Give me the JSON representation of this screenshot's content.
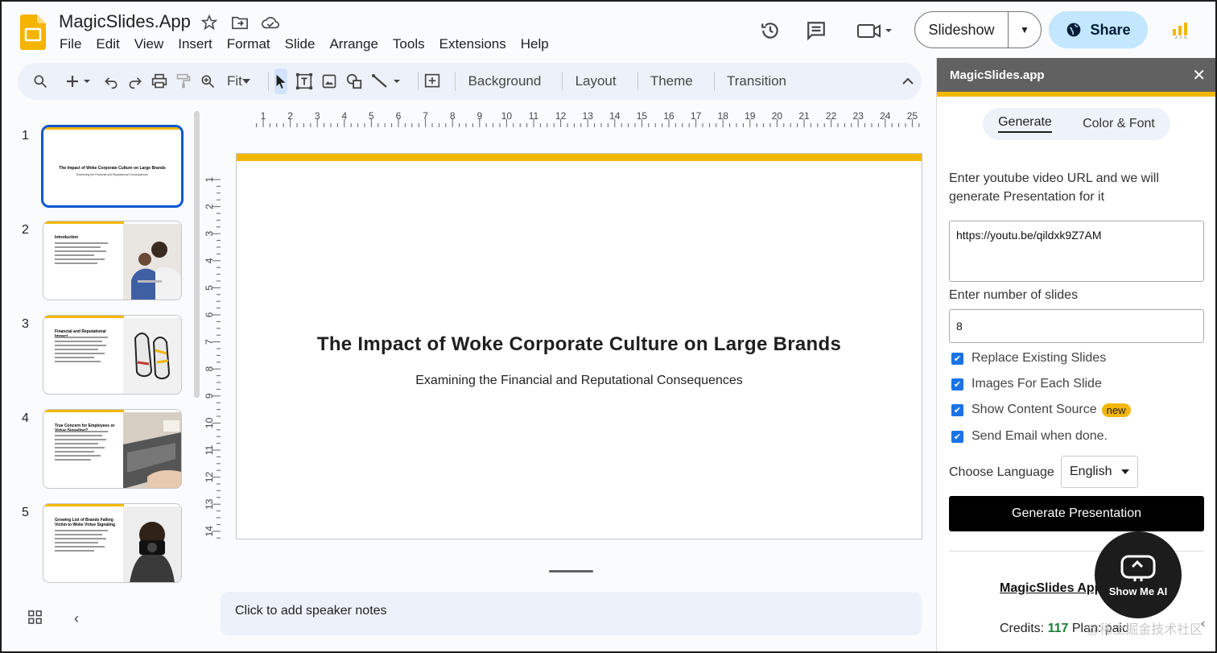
{
  "app": {
    "title": "MagicSlides.App",
    "menu": [
      "File",
      "Edit",
      "View",
      "Insert",
      "Format",
      "Slide",
      "Arrange",
      "Tools",
      "Extensions",
      "Help"
    ],
    "icons": [
      "star-icon",
      "move-to-folder-icon",
      "cloud-saved-icon"
    ]
  },
  "header": {
    "slideshow_label": "Slideshow",
    "share_label": "Share",
    "icons": [
      "history-icon",
      "comments-icon",
      "meet-camera-icon",
      "globe-icon",
      "account-icon"
    ]
  },
  "toolbar": {
    "zoom_value": "Fit",
    "background_label": "Background",
    "layout_label": "Layout",
    "theme_label": "Theme",
    "transition_label": "Transition"
  },
  "filmstrip": {
    "slides": [
      {
        "number": "1",
        "title": "The Impact of Woke Corporate Culture on Large Brands",
        "subtitle": "Examining the Financial and Reputational Consequences"
      },
      {
        "number": "2",
        "title": "Introduction"
      },
      {
        "number": "3",
        "title": "Financial and Reputational Impact"
      },
      {
        "number": "4",
        "title": "True Concern for Employees or Virtue Signaling?"
      },
      {
        "number": "5",
        "title": "Growing List of Brands Falling Victim to Woke Virtue Signaling"
      }
    ]
  },
  "ruler": {
    "h_ticks": [
      "1",
      "2",
      "3",
      "4",
      "5",
      "6",
      "7",
      "8",
      "9",
      "10",
      "11",
      "12",
      "13",
      "14",
      "15",
      "16",
      "17",
      "18",
      "19",
      "20",
      "21",
      "22",
      "23",
      "24",
      "25"
    ],
    "v_ticks": [
      "1",
      "2",
      "3",
      "4",
      "5",
      "6",
      "7",
      "8",
      "9",
      "10",
      "11",
      "12",
      "13",
      "14"
    ]
  },
  "slide": {
    "title": "The Impact of Woke Corporate Culture on Large Brands",
    "subtitle": "Examining the Financial and Reputational Consequences",
    "accent_color": "#f2b705"
  },
  "notes": {
    "placeholder": "Click to add speaker notes"
  },
  "panel": {
    "header": "MagicSlides.app",
    "tabs": [
      "Generate",
      "Color & Font"
    ],
    "url_prompt": "Enter youtube video URL and we will generate Presentation for it",
    "url_value": "https://youtu.be/qildxk9Z7AM",
    "slides_label": "Enter number of slides",
    "slides_value": "8",
    "options": [
      {
        "label": "Replace Existing Slides",
        "checked": true
      },
      {
        "label": "Images For Each Slide",
        "checked": true
      },
      {
        "label": "Show Content Source",
        "checked": true,
        "badge": "new"
      },
      {
        "label": "Send Email when done.",
        "checked": true
      }
    ],
    "language_label": "Choose Language",
    "language_value": "English",
    "generate_label": "Generate Presentation",
    "brand_link": "MagicSlides App",
    "credits_label": "Credits:",
    "credits_value": "117",
    "plan_label": "Plan: paid"
  },
  "overlay": {
    "showme_label": "Show Me AI",
    "watermark": "@稀土掘金技术社区"
  }
}
